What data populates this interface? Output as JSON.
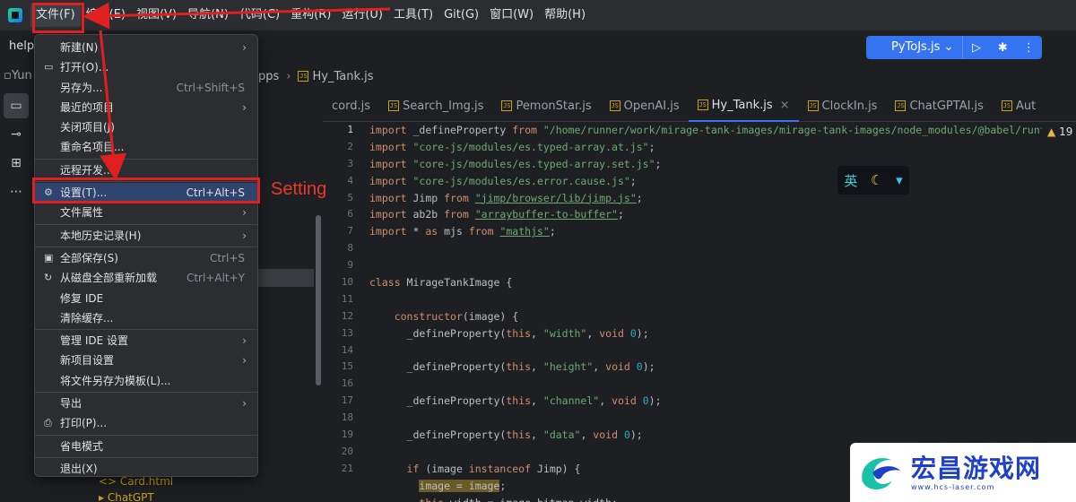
{
  "menubar": {
    "items": [
      "文件(F)",
      "编辑(E)",
      "视图(V)",
      "导航(N)",
      "代码(C)",
      "重构(R)",
      "运行(U)",
      "工具(T)",
      "Git(G)",
      "窗口(W)",
      "帮助(H)"
    ]
  },
  "project": {
    "title": "help",
    "crumb_left": "Yun",
    "breadcrumb_prev": "pps",
    "breadcrumb_file": "Hy_Tank.js"
  },
  "toolbar": {
    "run_config": "PyToJs.js"
  },
  "file_menu": {
    "items": [
      {
        "label": "新建(N)",
        "shortcut": "",
        "submenu": true,
        "icon": ""
      },
      {
        "label": "打开(O)...",
        "shortcut": "",
        "submenu": false,
        "icon": "folder-icon"
      },
      {
        "label": "另存为...",
        "shortcut": "Ctrl+Shift+S",
        "submenu": false,
        "icon": ""
      },
      {
        "label": "最近的项目",
        "shortcut": "",
        "submenu": true,
        "icon": ""
      },
      {
        "label": "关闭项目(J)",
        "shortcut": "",
        "submenu": false,
        "icon": ""
      },
      {
        "label": "重命名项目...",
        "shortcut": "",
        "submenu": false,
        "icon": ""
      },
      {
        "label": "远程开发...",
        "shortcut": "",
        "submenu": false,
        "icon": ""
      },
      {
        "label": "设置(T)...",
        "shortcut": "Ctrl+Alt+S",
        "submenu": false,
        "icon": "gear-icon"
      },
      {
        "label": "文件属性",
        "shortcut": "",
        "submenu": true,
        "icon": ""
      },
      {
        "label": "本地历史记录(H)",
        "shortcut": "",
        "submenu": true,
        "icon": ""
      },
      {
        "label": "全部保存(S)",
        "shortcut": "Ctrl+S",
        "submenu": false,
        "icon": "save-icon"
      },
      {
        "label": "从磁盘全部重新加载",
        "shortcut": "Ctrl+Alt+Y",
        "submenu": false,
        "icon": "reload-icon"
      },
      {
        "label": "修复 IDE",
        "shortcut": "",
        "submenu": false,
        "icon": ""
      },
      {
        "label": "清除缓存...",
        "shortcut": "",
        "submenu": false,
        "icon": ""
      },
      {
        "label": "管理 IDE 设置",
        "shortcut": "",
        "submenu": true,
        "icon": ""
      },
      {
        "label": "新项目设置",
        "shortcut": "",
        "submenu": true,
        "icon": ""
      },
      {
        "label": "将文件另存为模板(L)...",
        "shortcut": "",
        "submenu": false,
        "icon": ""
      },
      {
        "label": "导出",
        "shortcut": "",
        "submenu": true,
        "icon": ""
      },
      {
        "label": "打印(P)...",
        "shortcut": "",
        "submenu": false,
        "icon": "print-icon"
      },
      {
        "label": "省电模式",
        "shortcut": "",
        "submenu": false,
        "icon": ""
      },
      {
        "label": "退出(X)",
        "shortcut": "",
        "submenu": false,
        "icon": ""
      }
    ]
  },
  "annotation": {
    "settings_label": "Setting"
  },
  "tabs": [
    {
      "label": "cord.js",
      "active": false
    },
    {
      "label": "Search_Img.js",
      "active": false
    },
    {
      "label": "PemonStar.js",
      "active": false
    },
    {
      "label": "OpenAI.js",
      "active": false
    },
    {
      "label": "Hy_Tank.js",
      "active": true
    },
    {
      "label": "ClockIn.js",
      "active": false
    },
    {
      "label": "ChatGPTAI.js",
      "active": false
    },
    {
      "label": "Aut",
      "active": false
    }
  ],
  "editor": {
    "warnings": "19",
    "line_numbers": [
      "1",
      "2",
      "3",
      "4",
      "5",
      "6",
      "7",
      "8",
      "9",
      "10",
      "11",
      "12",
      "13",
      "14",
      "15",
      "16",
      "17",
      "18",
      "19",
      "20",
      "21"
    ]
  },
  "tree": {
    "rows": [
      "<> Card.html",
      "ChatGPT"
    ]
  },
  "ime": {
    "lang": "英"
  },
  "watermark": {
    "title": "宏昌游戏网",
    "url": "www.hcs-laser.com"
  },
  "colors": {
    "accent": "#3574f0",
    "annotation": "#e02020",
    "selected": "#2e436e"
  }
}
